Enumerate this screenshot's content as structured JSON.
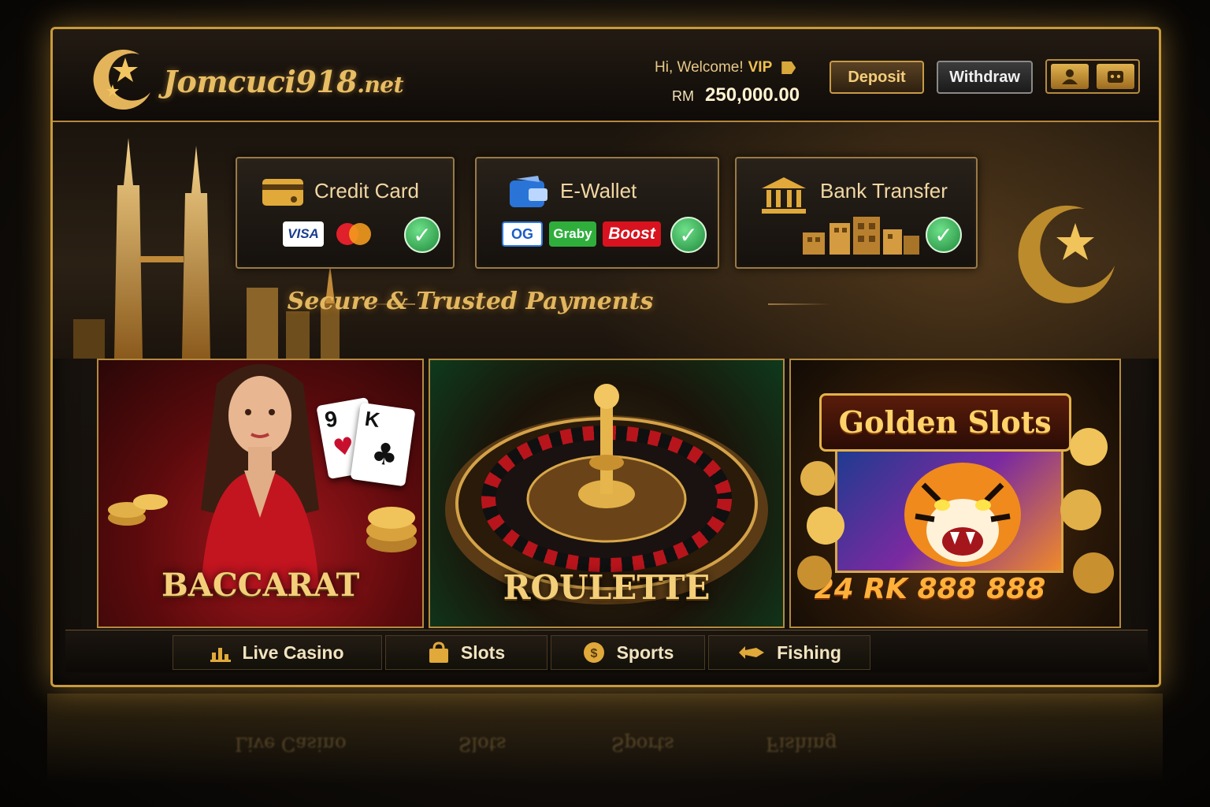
{
  "header": {
    "logo_text": "Jomcuci918",
    "logo_suffix": ".net",
    "welcome_text": "Hi, Welcome!",
    "vip_label": "VIP",
    "currency": "RM",
    "balance": "250,000.00",
    "deposit_label": "Deposit",
    "withdraw_label": "Withdraw",
    "icons": [
      "user-icon",
      "wallet-icon"
    ]
  },
  "payments": {
    "methods": [
      {
        "label": "Credit Card",
        "icon": "credit-card-icon",
        "badges": [
          "VISA",
          "mastercard"
        ],
        "verified": true
      },
      {
        "label": "E-Wallet",
        "icon": "e-wallet-icon",
        "badges": [
          "OG",
          "Graby",
          "Boost"
        ],
        "verified": true
      },
      {
        "label": "Bank Transfer",
        "icon": "bank-icon",
        "badges": [
          "bank-buildings"
        ],
        "verified": true
      }
    ],
    "tagline": "Secure & Trusted Payments"
  },
  "games": [
    {
      "label": "BACCARAT",
      "cards": [
        "9",
        "K"
      ]
    },
    {
      "label": "ROULETTE"
    },
    {
      "label": "Golden Slots",
      "banner": "24 RK 888 888"
    }
  ],
  "nav": {
    "items": [
      {
        "label": "Live Casino",
        "icon": "live-casino-icon"
      },
      {
        "label": "Slots",
        "icon": "bag-icon"
      },
      {
        "label": "Sports",
        "icon": "coin-icon"
      },
      {
        "label": "Fishing",
        "icon": "fish-icon"
      }
    ]
  },
  "colors": {
    "gold": "#c99a3c",
    "accent": "#e3b75f",
    "success": "#1f8a3b",
    "background": "#130f0b"
  }
}
